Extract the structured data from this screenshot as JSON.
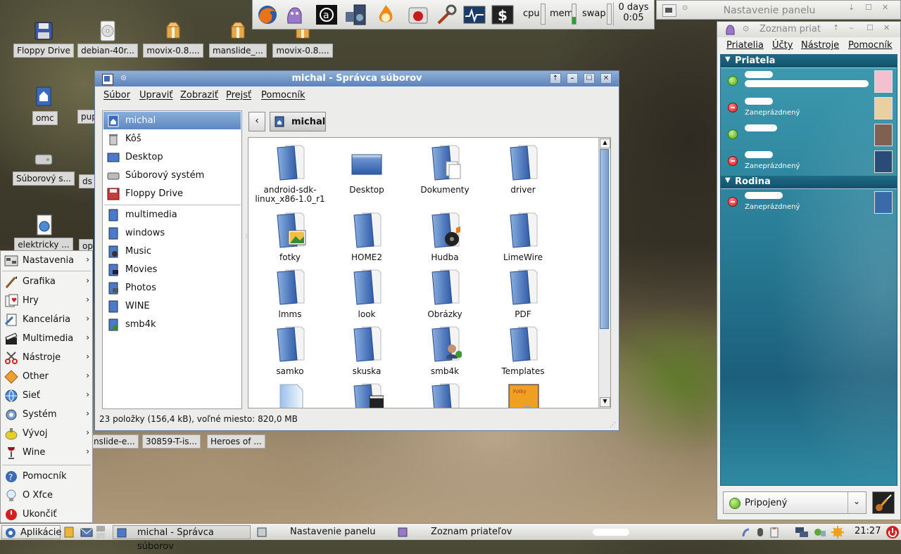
{
  "desktop_icons": [
    {
      "label": "Floppy Drive",
      "icon": "floppy-icon"
    },
    {
      "label": "debian-40r...",
      "icon": "cdrom-icon"
    },
    {
      "label": "movix-0.8....",
      "icon": "package-icon"
    },
    {
      "label": "manslide_...",
      "icon": "package-icon"
    },
    {
      "label": "movix-0.8....",
      "icon": "package-icon"
    },
    {
      "label": "omc",
      "icon": "home-icon"
    },
    {
      "label": "pup",
      "icon": "file-icon"
    },
    {
      "label": "Súborový s...",
      "icon": "harddisk-icon"
    },
    {
      "label": "ds",
      "icon": "file-icon"
    },
    {
      "label": "elektricky ...",
      "icon": "document-globe-icon"
    },
    {
      "label": "opc",
      "icon": "file-icon"
    },
    {
      "label": "nslide-e...",
      "icon": "file-icon"
    },
    {
      "label": "30859-T-is...",
      "icon": "file-icon"
    },
    {
      "label": "Heroes of ...",
      "icon": "file-icon"
    }
  ],
  "top_panel": {
    "launchers": [
      "firefox-icon",
      "pidgin-icon",
      "amarok-icon",
      "audio-player-icon",
      "flame-icon",
      "media-icon",
      "tools-icon",
      "system-monitor-icon",
      "terminal-icon"
    ],
    "cpu_label": "cpu",
    "cpu_level": 0.0,
    "mem_label": "mem",
    "mem_level": 0.35,
    "swap_label": "swap",
    "swap_level": 0.0,
    "uptime_days": "0 days",
    "uptime_time": "0:05"
  },
  "panel_settings_window": {
    "title": "Nastavenie panelu"
  },
  "file_manager": {
    "title": "michal - Správca súborov",
    "menu": [
      "Súbor",
      "Upraviť",
      "Zobraziť",
      "Prejsť",
      "Pomocník"
    ],
    "path_button": "michal",
    "sidebar": [
      {
        "label": "michal",
        "icon": "home-folder-icon",
        "selected": true
      },
      {
        "label": "Kôš",
        "icon": "trash-icon"
      },
      {
        "label": "Desktop",
        "icon": "desktop-icon"
      },
      {
        "label": "Súborový systém",
        "icon": "harddisk-icon"
      },
      {
        "label": "Floppy Drive",
        "icon": "floppy-icon"
      },
      {
        "label": "multimedia",
        "icon": "folder-icon"
      },
      {
        "label": "windows",
        "icon": "folder-icon"
      },
      {
        "label": "Music",
        "icon": "music-folder-icon"
      },
      {
        "label": "Movies",
        "icon": "movies-folder-icon"
      },
      {
        "label": "Photos",
        "icon": "photos-folder-icon"
      },
      {
        "label": "WINE",
        "icon": "folder-icon"
      },
      {
        "label": "smb4k",
        "icon": "network-folder-icon"
      }
    ],
    "files": [
      {
        "label": "android-sdk-linux_x86-1.0_r1",
        "line1": "android-sdk-",
        "line2": "linux_x86-1.0_r1",
        "icon": "folder-icon"
      },
      {
        "label": "Desktop",
        "icon": "desktop-icon"
      },
      {
        "label": "Dokumenty",
        "icon": "documents-folder-icon"
      },
      {
        "label": "driver",
        "icon": "folder-icon"
      },
      {
        "label": "fotky",
        "icon": "pictures-folder-icon"
      },
      {
        "label": "HOME2",
        "icon": "folder-icon"
      },
      {
        "label": "Hudba",
        "icon": "music-folder-icon"
      },
      {
        "label": "LimeWire",
        "icon": "folder-icon"
      },
      {
        "label": "lmms",
        "icon": "folder-icon"
      },
      {
        "label": "look",
        "icon": "folder-icon"
      },
      {
        "label": "Obrázky",
        "icon": "folder-icon"
      },
      {
        "label": "PDF",
        "icon": "folder-icon"
      },
      {
        "label": "samko",
        "icon": "folder-icon"
      },
      {
        "label": "skuska",
        "icon": "folder-icon"
      },
      {
        "label": "smb4k",
        "icon": "network-folder-icon"
      },
      {
        "label": "Templates",
        "icon": "folder-icon"
      },
      {
        "label": "",
        "icon": "document-icon"
      },
      {
        "label": "",
        "icon": "video-folder-icon"
      },
      {
        "label": "",
        "icon": "folder-icon"
      },
      {
        "label": "",
        "icon": "image-file-icon"
      }
    ],
    "status": "23 položky (156,4 kB), voľné miesto: 820,0 MB"
  },
  "app_menu": {
    "items": [
      {
        "label": "Nastavenia",
        "icon": "settings-icon",
        "submenu": true
      },
      {
        "label": "Grafika",
        "icon": "brush-icon",
        "submenu": true
      },
      {
        "label": "Hry",
        "icon": "cards-icon",
        "submenu": true
      },
      {
        "label": "Kancelária",
        "icon": "office-icon",
        "submenu": true
      },
      {
        "label": "Multimedia",
        "icon": "clapper-icon",
        "submenu": true
      },
      {
        "label": "Nástroje",
        "icon": "scissors-icon",
        "submenu": true
      },
      {
        "label": "Other",
        "icon": "other-icon",
        "submenu": true
      },
      {
        "label": "Sieť",
        "icon": "network-globe-icon",
        "submenu": true
      },
      {
        "label": "Systém",
        "icon": "gear-icon",
        "submenu": true
      },
      {
        "label": "Vývoj",
        "icon": "development-icon",
        "submenu": true
      },
      {
        "label": "Wine",
        "icon": "wine-glass-icon",
        "submenu": true
      }
    ],
    "footer_items": [
      {
        "label": "Pomocník",
        "icon": "help-icon"
      },
      {
        "label": "O Xfce",
        "icon": "lightbulb-icon"
      },
      {
        "label": "Ukončiť",
        "icon": "power-icon"
      }
    ],
    "arrow": "›"
  },
  "buddy_list": {
    "title": "Zoznam priat",
    "menu": [
      "Priatelia",
      "Účty",
      "Nástroje",
      "Pomocník"
    ],
    "groups": [
      {
        "name": "Priatela",
        "buddies": [
          {
            "status": "online",
            "status_text": ""
          },
          {
            "status": "busy",
            "status_text": "Zaneprázdnený"
          },
          {
            "status": "online",
            "status_text": ""
          },
          {
            "status": "busy",
            "status_text": "Zaneprázdnený"
          }
        ]
      },
      {
        "name": "Rodina",
        "buddies": [
          {
            "status": "busy",
            "status_text": "Zaneprázdnený"
          }
        ]
      }
    ],
    "status_selector": "Pripojený",
    "colors": {
      "online": "#52a81a",
      "busy": "#d01c1c",
      "accent": "#2a7f98"
    }
  },
  "taskbar": {
    "apps_label": "Aplikácie",
    "tasks": [
      {
        "label": "michal - Správca súborov",
        "icon": "file-manager-icon",
        "active": true
      },
      {
        "label": "Nastavenie panelu",
        "icon": "panel-settings-icon"
      },
      {
        "label": "Zoznam priateľov",
        "icon": "pidgin-icon"
      }
    ],
    "clock": "21:27"
  }
}
